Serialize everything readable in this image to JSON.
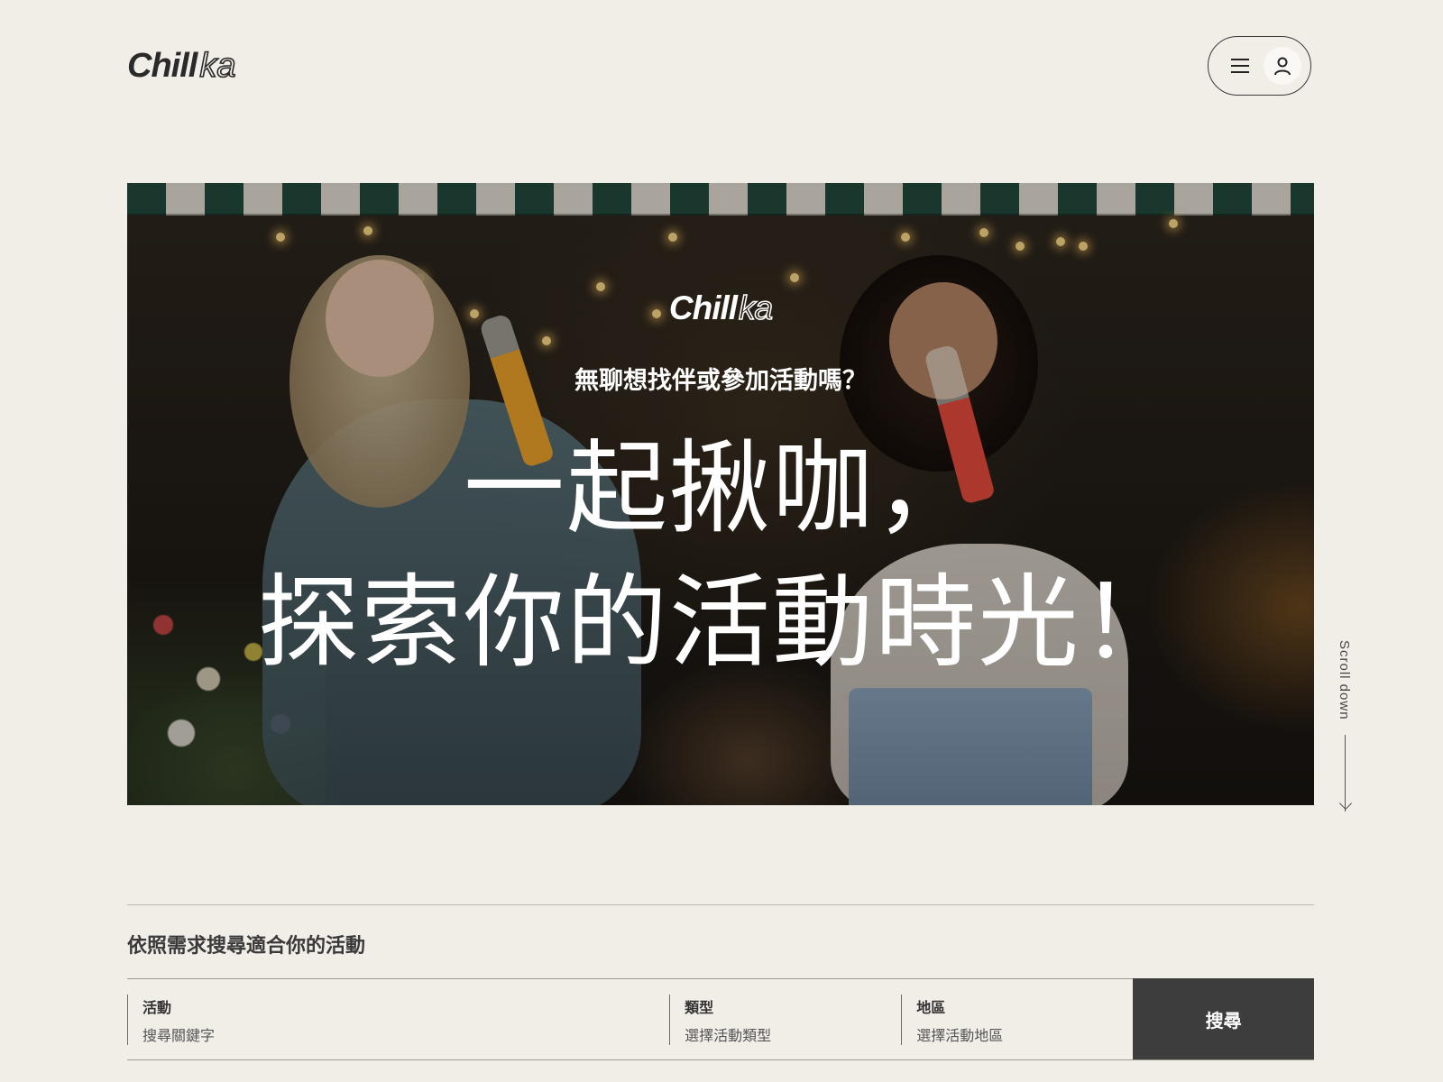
{
  "header": {
    "logo_a": "Chill",
    "logo_b": "ka",
    "menu_icon": "hamburger-menu-icon",
    "user_icon": "user-icon"
  },
  "hero": {
    "logo_a": "Chill",
    "logo_b": "ka",
    "subtitle": "無聊想找伴或參加活動嗎？",
    "title_line1": "一起揪咖，",
    "title_line2": "探索你的活動時光！"
  },
  "scroll": {
    "label": "Scroll down"
  },
  "search": {
    "heading": "依照需求搜尋適合你的活動",
    "fields": [
      {
        "label": "活動",
        "placeholder": "搜尋關鍵字"
      },
      {
        "label": "類型",
        "placeholder": "選擇活動類型"
      },
      {
        "label": "地區",
        "placeholder": "選擇活動地區"
      }
    ],
    "button_label": "搜尋"
  },
  "colors": {
    "background": "#f1eee8",
    "text": "#2b2b2b",
    "button": "#3d3d3d",
    "awning_green": "#1f4a3b"
  }
}
